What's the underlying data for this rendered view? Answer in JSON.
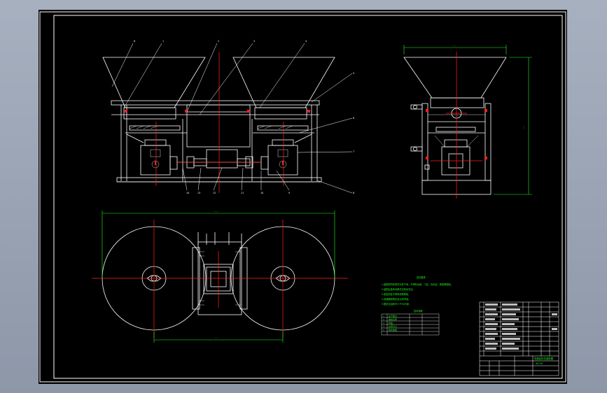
{
  "colors": {
    "background": "#000000",
    "outline": "#ffffff",
    "centerline": "#ff2020",
    "dimension": "#19ff19",
    "notes": "#19ff19",
    "window_frame": "#9aa3b2"
  },
  "drawing": {
    "front_view": {
      "part_numbers": [
        "8",
        "1",
        "2",
        "3",
        "4",
        "5",
        "6",
        "7",
        "8",
        "9",
        "10",
        "11",
        "12",
        "13",
        "14"
      ]
    },
    "side_view": {
      "dim_top": "---",
      "dim_right": "---"
    },
    "top_view": {
      "dim_top": "----",
      "dim_bottom": "---"
    },
    "notes_title": "技术要求",
    "notes": [
      "1.装配前所有零件清洗干净，不得有毛刺、飞边、氧化皮、锈蚀等缺陷。",
      "2.装配后各转动部件应转动灵活。",
      "3.各密封处不得有渗漏现象。",
      "4.减速器按规定加注润滑油。",
      "5.整机试运转不少于30分钟。"
    ],
    "params_title": "技术参数",
    "params": [
      [
        "1",
        "生产能力",
        "",
        "",
        ""
      ],
      [
        "2",
        "电机功率",
        "",
        "",
        ""
      ],
      [
        "3",
        "转速",
        "",
        "",
        ""
      ],
      [
        "4",
        "外形尺寸",
        "",
        "",
        ""
      ],
      [
        "5",
        "整机重量",
        "",
        "",
        ""
      ]
    ],
    "title_block": {
      "drawing_name": "双盘给料机装配图",
      "drawing_number": "00-00"
    }
  }
}
